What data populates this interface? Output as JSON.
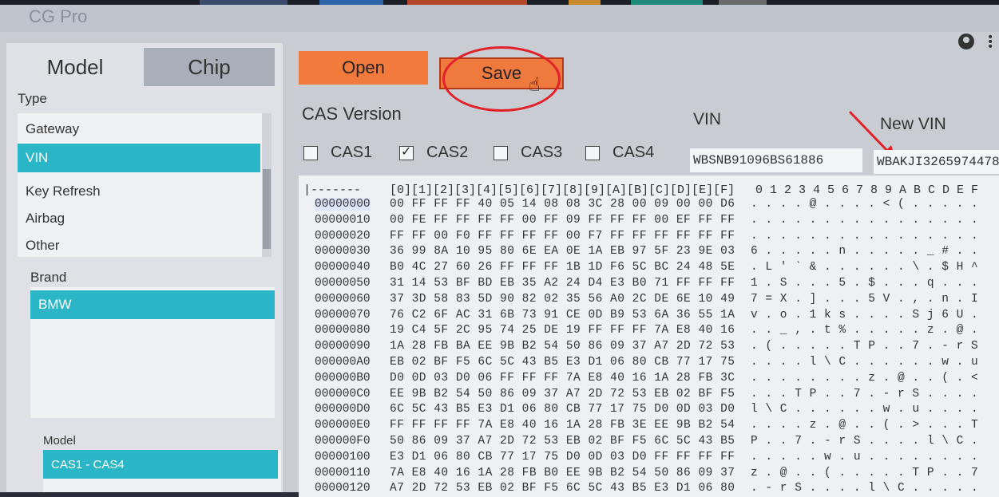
{
  "app": {
    "title": "CG Pro"
  },
  "left_tabs": [
    {
      "label": "Model"
    },
    {
      "label": "Chip"
    }
  ],
  "type_section": {
    "label": "Type",
    "items": [
      {
        "label": "Gateway",
        "selected": false
      },
      {
        "label": "VIN",
        "selected": true
      },
      {
        "label": "Key Refresh",
        "selected": false
      },
      {
        "label": "Airbag",
        "selected": false
      },
      {
        "label": "Other",
        "selected": false
      }
    ]
  },
  "brand_section": {
    "label": "Brand",
    "items": [
      {
        "label": "BMW",
        "selected": true
      }
    ]
  },
  "model_section": {
    "label": "Model",
    "items": [
      {
        "label": "CAS1 - CAS4",
        "selected": true
      }
    ]
  },
  "toolbar": {
    "open_label": "Open",
    "save_label": "Save"
  },
  "cas": {
    "label": "CAS Version",
    "options": [
      {
        "label": "CAS1",
        "checked": false
      },
      {
        "label": "CAS2",
        "checked": true
      },
      {
        "label": "CAS3",
        "checked": false
      },
      {
        "label": "CAS4",
        "checked": false
      }
    ]
  },
  "vin": {
    "label": "VIN",
    "value": "WBSNB91096BS61886"
  },
  "new_vin": {
    "label": "New VIN",
    "value": "WBAKJI3265974478"
  },
  "hex": {
    "header_prefix": "|-------",
    "header_cols": "[0][1][2][3][4][5][6][7][8][9][A][B][C][D][E][F]",
    "header_ascii": "0 1 2 3 4 5 6 7 8 9 A B C D E F",
    "rows": [
      {
        "addr": "00000000",
        "bytes": "00 FF FF FF 40 05 14 08 08 3C 28 00 09 00 00 D6",
        "ascii": ". . . . @ . . . . < ( . . . . ."
      },
      {
        "addr": "00000010",
        "bytes": "00 FE FF FF FF FF 00 FF 09 FF FF FF 00 EF FF FF",
        "ascii": ". . . . . . . . . . . . . . . ."
      },
      {
        "addr": "00000020",
        "bytes": "FF FF 00 F0 FF FF FF FF 00 F7 FF FF FF FF FF FF",
        "ascii": ". . . . . . . . . . . . . . . ."
      },
      {
        "addr": "00000030",
        "bytes": "36 99 8A 10 95 80 6E EA 0E 1A EB 97 5F 23 9E 03",
        "ascii": "6 . . . . . n . . . . . _ # . ."
      },
      {
        "addr": "00000040",
        "bytes": "B0 4C 27 60 26 FF FF FF 1B 1D F6 5C BC 24 48 5E",
        "ascii": ". L ' ` & . . . . . . \\ . $ H ^"
      },
      {
        "addr": "00000050",
        "bytes": "31 14 53 BF BD EB 35 A2 24 D4 E3 B0 71 FF FF FF",
        "ascii": "1 . S . . . 5 . $ . . . q . . ."
      },
      {
        "addr": "00000060",
        "bytes": "37 3D 58 83 5D 90 82 02 35 56 A0 2C DE 6E 10 49",
        "ascii": "7 = X . ] . . . 5 V . , . n . I"
      },
      {
        "addr": "00000070",
        "bytes": "76 C2 6F AC 31 6B 73 91 CE 0D B9 53 6A 36 55 1A",
        "ascii": "v . o . 1 k s . . . . S j 6 U ."
      },
      {
        "addr": "00000080",
        "bytes": "19 C4 5F 2C 95 74 25 DE 19 FF FF FF 7A E8 40 16",
        "ascii": ". . _ , . t % . . . . . z . @ ."
      },
      {
        "addr": "00000090",
        "bytes": "1A 28 FB BA EE 9B B2 54 50 86 09 37 A7 2D 72 53",
        "ascii": ". ( . . . . . T P . . 7 . - r S"
      },
      {
        "addr": "000000A0",
        "bytes": "EB 02 BF F5 6C 5C 43 B5 E3 D1 06 80 CB 77 17 75",
        "ascii": ". . . . l \\ C . . . . . . w . u"
      },
      {
        "addr": "000000B0",
        "bytes": "D0 0D 03 D0 06 FF FF FF 7A E8 40 16 1A 28 FB 3C",
        "ascii": ". . . . . . . . z . @ . . ( . <"
      },
      {
        "addr": "000000C0",
        "bytes": "EE 9B B2 54 50 86 09 37 A7 2D 72 53 EB 02 BF F5",
        "ascii": ". . . T P . . 7 . - r S . . . ."
      },
      {
        "addr": "000000D0",
        "bytes": "6C 5C 43 B5 E3 D1 06 80 CB 77 17 75 D0 0D 03 D0",
        "ascii": "l \\ C . . . . . . w . u . . . ."
      },
      {
        "addr": "000000E0",
        "bytes": "FF FF FF FF 7A E8 40 16 1A 28 FB 3E EE 9B B2 54",
        "ascii": ". . . . z . @ . . ( . > . . . T"
      },
      {
        "addr": "000000F0",
        "bytes": "50 86 09 37 A7 2D 72 53 EB 02 BF F5 6C 5C 43 B5",
        "ascii": "P . . 7 . - r S . . . . l \\ C ."
      },
      {
        "addr": "00000100",
        "bytes": "E3 D1 06 80 CB 77 17 75 D0 0D 03 D0 FF FF FF FF",
        "ascii": ". . . . . w . u . . . . . . . ."
      },
      {
        "addr": "00000110",
        "bytes": "7A E8 40 16 1A 28 FB B0 EE 9B B2 54 50 86 09 37",
        "ascii": "z . @ . . ( . . . . . T P . . 7"
      },
      {
        "addr": "00000120",
        "bytes": "A7 2D 72 53 EB 02 BF F5 6C 5C 43 B5 E3 D1 06 80",
        "ascii": ". - r S . . . . l \\ C . . . . ."
      }
    ]
  },
  "colors": {
    "accent": "#2bb6c8",
    "button": "#f27a3c",
    "highlight_ring": "#e1202a"
  }
}
